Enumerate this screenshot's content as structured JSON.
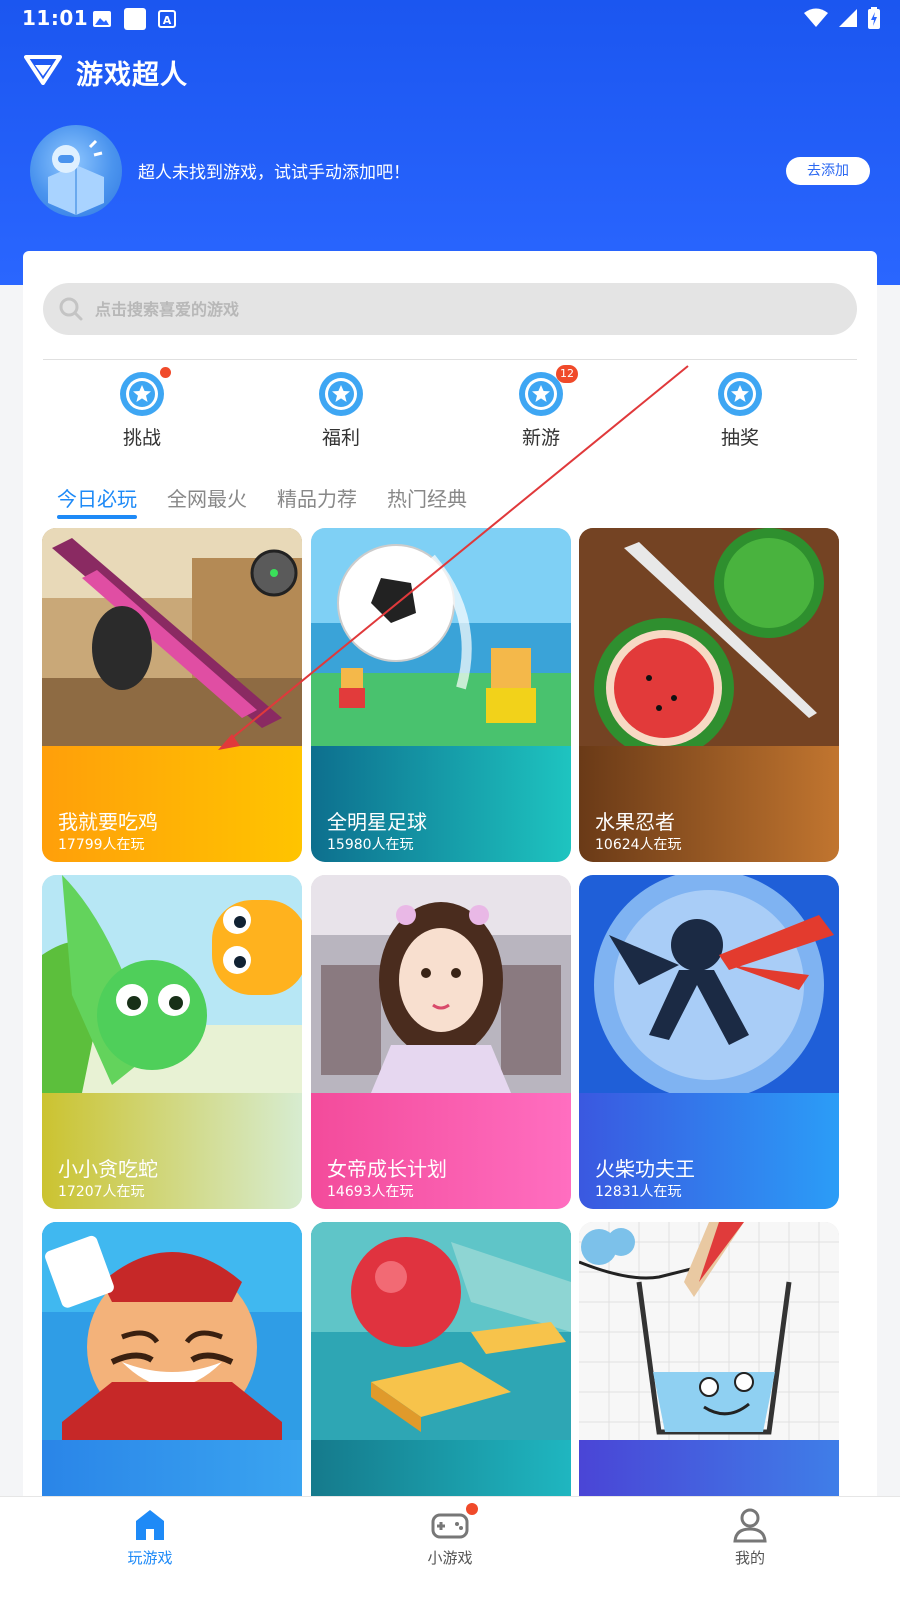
{
  "status_bar": {
    "time": "11:01"
  },
  "app": {
    "title": "游戏超人"
  },
  "notice": {
    "message": "超人未找到游戏，试试手动添加吧！",
    "button_label": "去添加"
  },
  "search": {
    "placeholder": "点击搜索喜爱的游戏"
  },
  "categories": [
    {
      "label": "挑战",
      "indicator": "dot"
    },
    {
      "label": "福利",
      "indicator": "none"
    },
    {
      "label": "新游",
      "indicator": "badge",
      "badge": "12"
    },
    {
      "label": "抽奖",
      "indicator": "none"
    }
  ],
  "tabs": [
    {
      "label": "今日必玩",
      "active": true
    },
    {
      "label": "全网最火",
      "active": false
    },
    {
      "label": "精品力荐",
      "active": false
    },
    {
      "label": "热门经典",
      "active": false
    }
  ],
  "games": [
    {
      "title": "我就要吃鸡",
      "players": "17799人在玩"
    },
    {
      "title": "全明星足球",
      "players": "15980人在玩"
    },
    {
      "title": "水果忍者",
      "players": "10624人在玩"
    },
    {
      "title": "小小贪吃蛇",
      "players": "17207人在玩"
    },
    {
      "title": "女帝成长计划",
      "players": "14693人在玩"
    },
    {
      "title": "火柴功夫王",
      "players": "12831人在玩"
    },
    {
      "title": "",
      "players": ""
    },
    {
      "title": "",
      "players": ""
    },
    {
      "title": "",
      "players": ""
    }
  ],
  "bottom_nav": [
    {
      "label": "玩游戏",
      "active": true
    },
    {
      "label": "小游戏",
      "active": false,
      "has_dot": true
    },
    {
      "label": "我的",
      "active": false
    }
  ],
  "colors": {
    "brand_blue": "#2a66ff",
    "accent": "#1e8af7",
    "alert_red": "#f04a2a"
  }
}
